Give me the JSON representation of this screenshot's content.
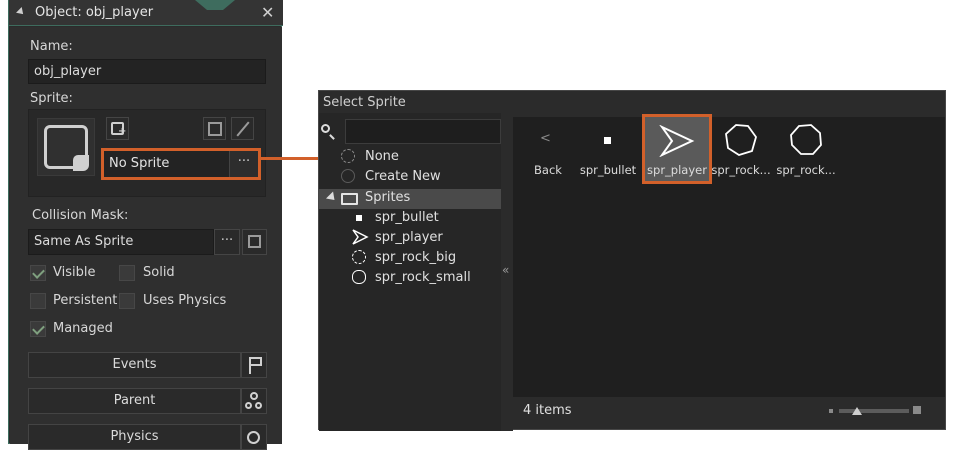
{
  "object_panel": {
    "title": "Object: obj_player",
    "name_label": "Name:",
    "name_value": "obj_player",
    "sprite_label": "Sprite:",
    "sprite_value": "No Sprite",
    "sprite_more": "···",
    "collision_label": "Collision Mask:",
    "collision_value": "Same As Sprite",
    "collision_more": "···",
    "checkboxes": [
      {
        "label": "Visible",
        "checked": true
      },
      {
        "label": "Solid",
        "checked": false
      },
      {
        "label": "Persistent",
        "checked": false
      },
      {
        "label": "Uses Physics",
        "checked": false
      },
      {
        "label": "Managed",
        "checked": true
      }
    ],
    "buttons": {
      "events": "Events",
      "parent": "Parent",
      "physics": "Physics"
    },
    "accent": "#3e6c5e"
  },
  "select_sprite": {
    "title": "Select Sprite",
    "tree": {
      "none": "None",
      "create_new": "Create New",
      "folder": "Sprites",
      "items": [
        "spr_bullet",
        "spr_player",
        "spr_rock_big",
        "spr_rock_small"
      ]
    },
    "collapse_glyph": "«",
    "grid": [
      {
        "label": "Back",
        "icon": "back-arrow-icon"
      },
      {
        "label": "spr_bullet",
        "icon": "bullet-icon"
      },
      {
        "label": "spr_player",
        "icon": "player-triangle-icon",
        "selected": true
      },
      {
        "label": "spr_rock...",
        "icon": "rock-big-icon"
      },
      {
        "label": "spr_rock...",
        "icon": "rock-small-icon"
      }
    ],
    "back_glyph": "<",
    "status": "4 items",
    "highlight_color": "#d2602a"
  }
}
